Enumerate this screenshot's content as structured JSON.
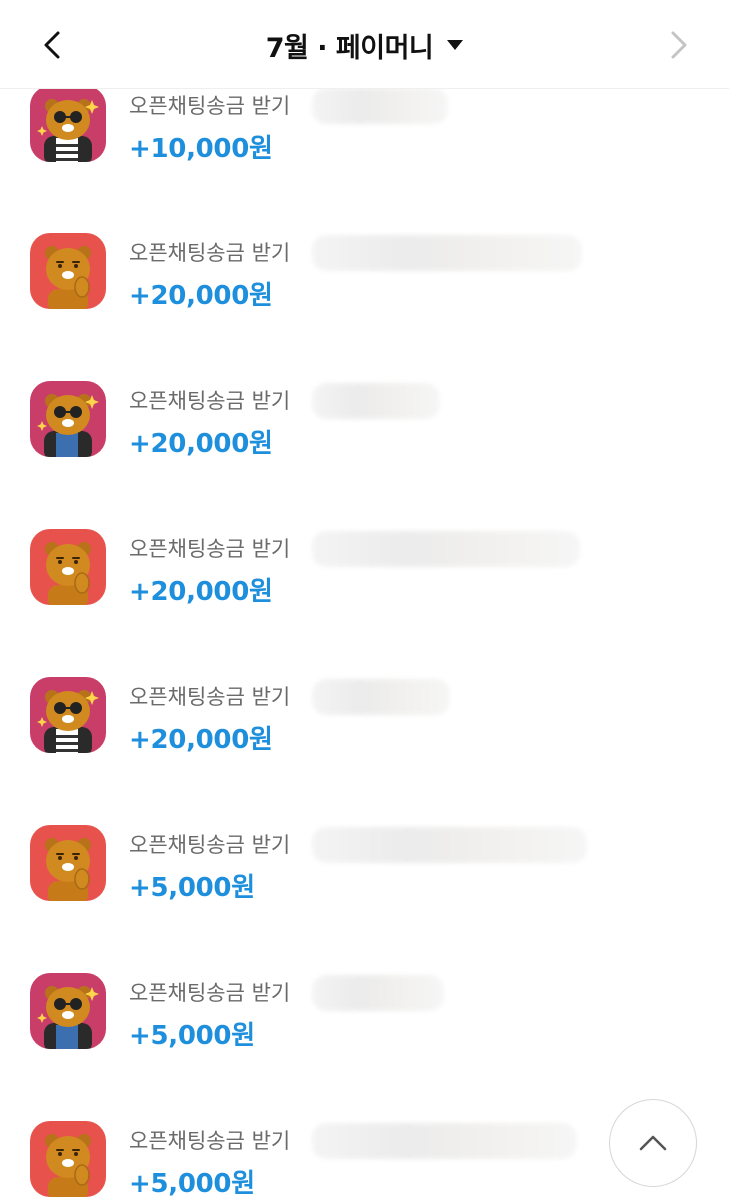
{
  "header": {
    "title": "7월 · 페이머니",
    "back_icon": "chevron-left-icon",
    "next_icon": "chevron-right-icon",
    "dropdown_icon": "caret-down-icon"
  },
  "transactions": [
    {
      "description": "오픈채팅송금 받기",
      "amount": "+10,000원",
      "avatar": "ryan-glasses-icon"
    },
    {
      "description": "오픈채팅송금 받기",
      "amount": "+20,000원",
      "avatar": "ryan-icon"
    },
    {
      "description": "오픈채팅송금 받기",
      "amount": "+20,000원",
      "avatar": "ryan-glasses-icon"
    },
    {
      "description": "오픈채팅송금 받기",
      "amount": "+20,000원",
      "avatar": "ryan-icon"
    },
    {
      "description": "오픈채팅송금 받기",
      "amount": "+20,000원",
      "avatar": "ryan-glasses-icon"
    },
    {
      "description": "오픈채팅송금 받기",
      "amount": "+5,000원",
      "avatar": "ryan-icon"
    },
    {
      "description": "오픈채팅송금 받기",
      "amount": "+5,000원",
      "avatar": "ryan-glasses-icon"
    },
    {
      "description": "오픈채팅송금 받기",
      "amount": "+5,000원",
      "avatar": "ryan-icon"
    }
  ],
  "scroll_top_icon": "chevron-up-icon",
  "colors": {
    "amount": "#1e8fdc",
    "avatar_pink": "#c93d69",
    "avatar_red": "#e8524d",
    "character_fur": "#d18a1f"
  }
}
